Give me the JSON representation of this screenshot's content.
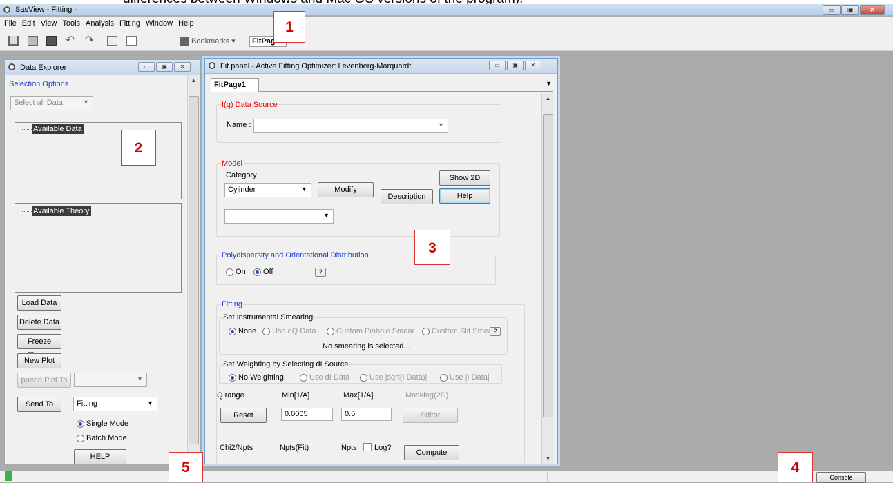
{
  "caption": "differences between Windows and Mac OS versions of the program).",
  "window": {
    "title": "SasView - Fitting -",
    "minimize": "▭",
    "maximize": "▣",
    "close": "✕"
  },
  "menu": [
    "File",
    "Edit",
    "View",
    "Tools",
    "Analysis",
    "Fitting",
    "Window",
    "Help"
  ],
  "toolbar": {
    "bookmarks_label": "Bookmarks ▾",
    "fitpage_label": "FitPage1"
  },
  "callouts": [
    "1",
    "2",
    "3",
    "4",
    "5"
  ],
  "explorer": {
    "title": "Data Explorer",
    "selection_options": "Selection Options",
    "select_combo": "Select all Data",
    "available_data": "Available Data",
    "available_theory": "Available Theory",
    "load_data": "Load Data",
    "delete_data": "Delete Data",
    "freeze_theory": "Freeze Theory",
    "new_plot": "New Plot",
    "append_plot": "ppend Plot To",
    "send_to": "Send To",
    "send_to_combo": "Fitting",
    "single_mode": "Single Mode",
    "batch_mode": "Batch Mode",
    "help": "HELP"
  },
  "fitpanel": {
    "title": "Fit panel - Active Fitting Optimizer: Levenberg-Marquardt",
    "tab": "FitPage1",
    "data_source_label": "I(q) Data Source",
    "name_label": "Name :",
    "model_label": "Model",
    "category_label": "Category",
    "category_combo": "Cylinder",
    "modify": "Modify",
    "description": "Description",
    "show2d": "Show 2D",
    "help": "Help",
    "poly_label": "Polydispersity and Orientational Distribution",
    "on": "On",
    "off": "Off",
    "qmark": "?",
    "fitting_label": "Fitting",
    "smearing_label": "Set Instrumental Smearing",
    "smear_none": "None",
    "smear_dq": "Use dQ Data",
    "smear_pinhole": "Custom Pinhole Smear",
    "smear_slit": "Custom Slit Smear",
    "no_smearing": "No smearing is selected...",
    "weighting_label": "Set Weighting by Selecting dI Source",
    "w_none": "No Weighting",
    "w_di": "Use dI Data",
    "w_sqrt": "Use |sqrt(I Data)|",
    "w_idata": "Use |I Data|",
    "q_range": "Q range",
    "min_label": "Min[1/A]",
    "max_label": "Max[1/A]",
    "masking": "Masking(2D)",
    "reset": "Reset",
    "min_value": "0.0005",
    "max_value": "0.5",
    "editor": "Editor",
    "chi2": "Chi2/Npts",
    "npts_fit": "Npts(Fit)",
    "npts": "Npts",
    "log": "Log?",
    "compute": "Compute"
  },
  "status": {
    "console": "Console"
  }
}
